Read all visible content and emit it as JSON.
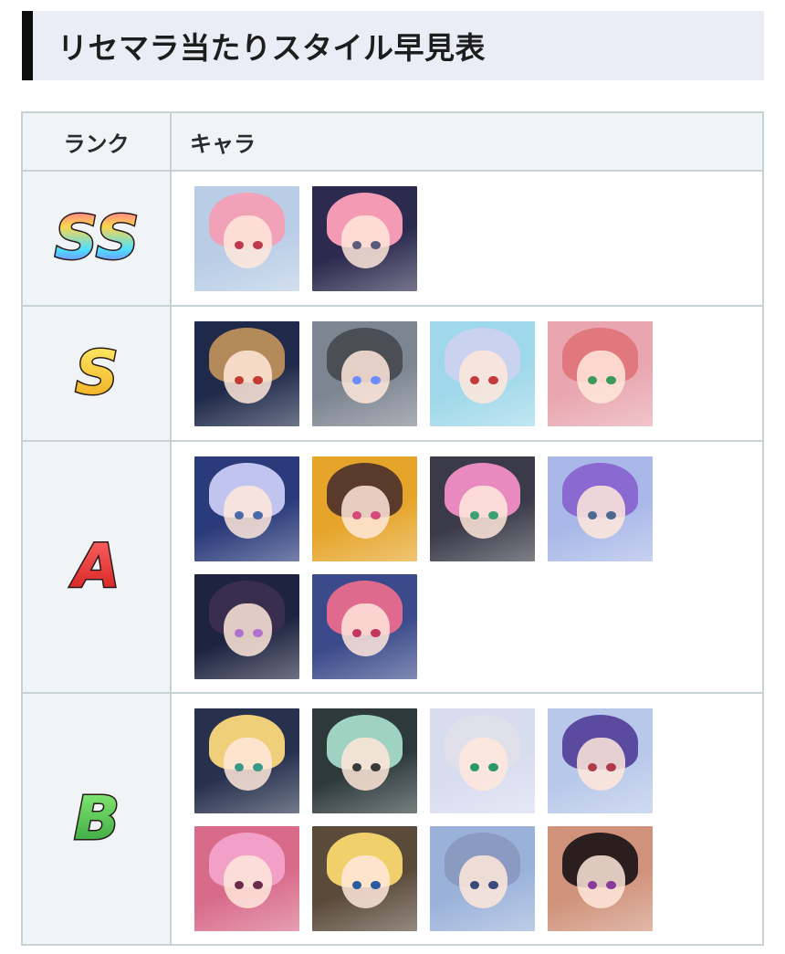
{
  "heading": {
    "title": "リセマラ当たりスタイル早見表"
  },
  "table": {
    "headers": {
      "rank": "ランク",
      "chara": "キャラ"
    },
    "rows": [
      {
        "rank": "SS",
        "rank_icon": "ss-rank-icon",
        "rank_colors": [
          "#ff4fb8",
          "#ffd54a",
          "#4de0ff",
          "#9b4dff"
        ],
        "characters": [
          {
            "icon": "character-portrait",
            "bg": "#b9cde6",
            "hair": "#f2a2b8",
            "eye": "#c0384e"
          },
          {
            "icon": "character-portrait",
            "bg": "#2c2a4e",
            "hair": "#f39ab5",
            "eye": "#5a5a7a"
          }
        ]
      },
      {
        "rank": "S",
        "rank_icon": "s-rank-icon",
        "rank_colors": [
          "#fff06a",
          "#f0a81a"
        ],
        "characters": [
          {
            "icon": "character-portrait",
            "bg": "#1f2a4a",
            "hair": "#b58a5a",
            "eye": "#c43a2e"
          },
          {
            "icon": "character-portrait",
            "bg": "#7d8590",
            "hair": "#4a4e55",
            "eye": "#6a8cff"
          },
          {
            "icon": "character-portrait",
            "bg": "#9fd8ea",
            "hair": "#c9d2ef",
            "eye": "#c23a3a"
          },
          {
            "icon": "character-portrait",
            "bg": "#e9a6b0",
            "hair": "#e0787e",
            "eye": "#3a9a5a"
          }
        ]
      },
      {
        "rank": "A",
        "rank_icon": "a-rank-icon",
        "rank_colors": [
          "#ff6a6a",
          "#d11818"
        ],
        "characters": [
          {
            "icon": "character-portrait",
            "bg": "#2a3a7a",
            "hair": "#c0c4ef",
            "eye": "#4a6aa8"
          },
          {
            "icon": "character-portrait",
            "bg": "#e6a52a",
            "hair": "#5a3a2a",
            "eye": "#d64a7a"
          },
          {
            "icon": "character-portrait",
            "bg": "#3a3a48",
            "hair": "#e88ac0",
            "eye": "#3aa070"
          },
          {
            "icon": "character-portrait",
            "bg": "#a9b8e8",
            "hair": "#8a6ad0",
            "eye": "#4a6a90"
          },
          {
            "icon": "character-portrait",
            "bg": "#1e2440",
            "hair": "#3a2e4e",
            "eye": "#b070d0"
          },
          {
            "icon": "character-portrait",
            "bg": "#3a4a8a",
            "hair": "#e0698e",
            "eye": "#c0385e"
          }
        ]
      },
      {
        "rank": "B",
        "rank_icon": "b-rank-icon",
        "rank_colors": [
          "#8ef07a",
          "#2ea03a"
        ],
        "characters": [
          {
            "icon": "character-portrait",
            "bg": "#27314e",
            "hair": "#f0cf7a",
            "eye": "#3a9a8a"
          },
          {
            "icon": "character-portrait",
            "bg": "#2e3a3a",
            "hair": "#9fd2c0",
            "eye": "#3a3a3a"
          },
          {
            "icon": "character-portrait",
            "bg": "#d8dcef",
            "hair": "#e0e0ea",
            "eye": "#2a9a6a"
          },
          {
            "icon": "character-portrait",
            "bg": "#b8c8ea",
            "hair": "#5a4aa0",
            "eye": "#b03a4a"
          },
          {
            "icon": "character-portrait",
            "bg": "#d86a8a",
            "hair": "#f2a0c8",
            "eye": "#6a2a4a"
          },
          {
            "icon": "character-portrait",
            "bg": "#5a4a3a",
            "hair": "#f0d06a",
            "eye": "#2a5aa0"
          },
          {
            "icon": "character-portrait",
            "bg": "#9ab2da",
            "hair": "#8a9ac0",
            "eye": "#3a4a7a"
          },
          {
            "icon": "character-portrait",
            "bg": "#d0927a",
            "hair": "#2a1e1e",
            "eye": "#8a3a9a"
          }
        ]
      }
    ]
  }
}
